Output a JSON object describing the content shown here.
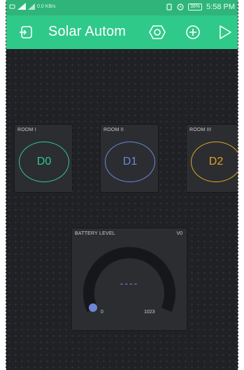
{
  "status_bar": {
    "left_tiny": "0.0",
    "left_tiny2": "KB/s",
    "battery_text": "38%",
    "time": "5:58 PM"
  },
  "app_bar": {
    "title": "Solar Autom",
    "icons": [
      "exit-icon",
      "settings-hexagon-icon",
      "add-icon",
      "play-icon"
    ]
  },
  "widgets": {
    "room1": {
      "label": "ROOM I",
      "pin": "D0",
      "color": "#2fc98a"
    },
    "room2": {
      "label": "ROOM II",
      "pin": "D1",
      "color": "#6e86d6"
    },
    "room3": {
      "label": "ROOM III",
      "pin": "D2",
      "color": "#e0a325"
    },
    "battery": {
      "label": "BATTERY LEVEL",
      "pin": "V0",
      "value": "----",
      "min": "0",
      "max": "1023",
      "level": 0,
      "color": "#6e86d6"
    }
  },
  "colors": {
    "accent": "#2fc98a",
    "background": "#202226",
    "widget": "#2b2d31"
  }
}
